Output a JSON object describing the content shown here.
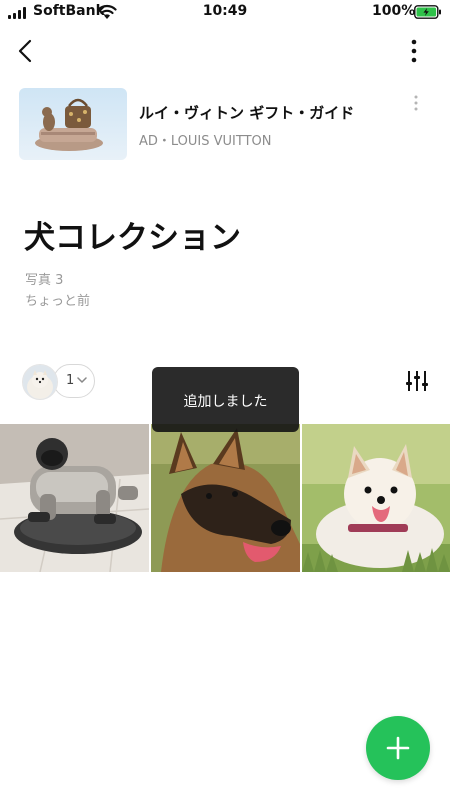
{
  "status_bar": {
    "carrier": "SoftBank",
    "time": "10:49",
    "battery": "100%"
  },
  "nav": {
    "back_icon": "chevron-left-icon",
    "more_icon": "vertical-dots-icon"
  },
  "ad": {
    "title": "ルイ・ヴィトン ギフト・ガイド",
    "subtitle": "AD・LOUIS VUITTON"
  },
  "album": {
    "title": "犬コレクション",
    "photo_count": "写真 3",
    "updated": "ちょっと前"
  },
  "members": {
    "count": "1"
  },
  "toast": {
    "message": "追加しました"
  },
  "photos": [
    {
      "subject": "robot-dog-photo"
    },
    {
      "subject": "german-shepherd-photo"
    },
    {
      "subject": "pomeranian-photo"
    }
  ],
  "colors": {
    "accent_green": "#25c25a",
    "battery_green": "#2fc24a",
    "toast_bg": "#1e1e1e"
  }
}
